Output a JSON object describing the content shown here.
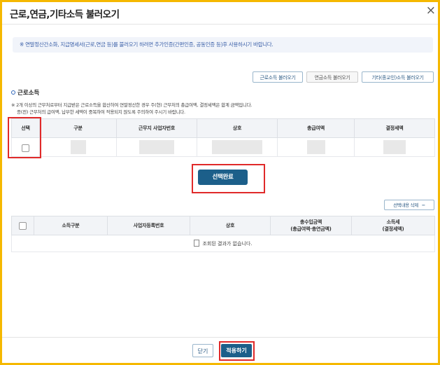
{
  "dialog": {
    "title": "근로,연금,기타소득 불러오기",
    "close_symbol": "×"
  },
  "notice": "※ 연말정산간소화, 지급명세서(근로,연금 등)를 불러오기 하려면 추가인증(간편인증, 공동인증 등)후 사용하시기 바랍니다.",
  "tabs": {
    "labor": "근로소득 불러오기",
    "pension": "연금소득 불러오기",
    "other": "기타(종교인)소득 불러오기"
  },
  "section": {
    "title": "근로소득",
    "note_line1": "※ 2개 이상의 근무처로부터 지급받은 근로소득을 합산하여 연말정산한 경우 주(현) 근무처의 총급여액, 결정세액은 합계 금액입니다.",
    "note_line2": "종(전) 근무처의 급여액, 납부한 세액이 중복하여 적용되지 않도록 주의하여 주시기 바랍니다."
  },
  "top_table": {
    "headers": [
      "선택",
      "구분",
      "근무지 사업자번호",
      "상호",
      "총급여액",
      "결정세액"
    ]
  },
  "select_done_button": "선택완료",
  "delete_selected_button": "선택내용 삭제",
  "delete_icon": "minus-icon",
  "bottom_table": {
    "headers": [
      "소득구분",
      "사업자등록번호",
      "상호",
      "총수입금액",
      "(총급여액·총연금액)",
      "소득세",
      "(결정세액)"
    ],
    "empty_message": "조회된 결과가 없습니다."
  },
  "footer": {
    "close_button": "닫기",
    "apply_button": "적용하기"
  },
  "colors": {
    "background_frame": "#f5b800",
    "primary": "#1c5f8a",
    "highlight": "#e02a2a",
    "notice_text": "#3a5fa8"
  }
}
